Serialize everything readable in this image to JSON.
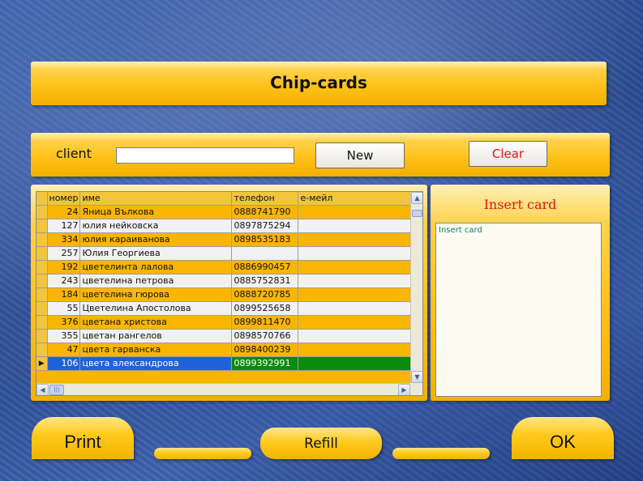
{
  "title": "Chip-cards",
  "client": {
    "label": "client",
    "value": "",
    "new_label": "New",
    "clear_label": "Clear"
  },
  "grid": {
    "columns": [
      "номер",
      "име",
      "телефон",
      "е-мейл"
    ],
    "rows": [
      {
        "num": "24",
        "name": "Яница Вълкова",
        "phone": "0888741790",
        "email": ""
      },
      {
        "num": "127",
        "name": "юлия нейковска",
        "phone": "0897875294",
        "email": ""
      },
      {
        "num": "334",
        "name": "юлия караиванова",
        "phone": "0898535183",
        "email": ""
      },
      {
        "num": "257",
        "name": "Юлия Георгиева",
        "phone": "",
        "email": ""
      },
      {
        "num": "192",
        "name": "цветелинта лалова",
        "phone": "0886990457",
        "email": ""
      },
      {
        "num": "243",
        "name": "цветелина петрова",
        "phone": "0885752831",
        "email": ""
      },
      {
        "num": "184",
        "name": "цветелина гюрова",
        "phone": "0888720785",
        "email": ""
      },
      {
        "num": "55",
        "name": "Цветелина Апостолова",
        "phone": "0899525658",
        "email": ""
      },
      {
        "num": "376",
        "name": "цветана христова",
        "phone": "0899811470",
        "email": ""
      },
      {
        "num": "355",
        "name": "цветан рангелов",
        "phone": "0898570766",
        "email": ""
      },
      {
        "num": "47",
        "name": "цвета гарванска",
        "phone": "0898400239",
        "email": ""
      },
      {
        "num": "106",
        "name": "цвета александрова",
        "phone": "0899392991",
        "email": "",
        "selected": true
      }
    ]
  },
  "insert_card": {
    "title": "Insert card",
    "message": "Insert card"
  },
  "buttons": {
    "print": "Print",
    "refill": "Refill",
    "ok": "OK"
  },
  "colors": {
    "gold": "#ffc21a",
    "selection_blue": "#1f62d8",
    "selection_green": "#0c8a0c",
    "clear_red": "#e01414"
  }
}
